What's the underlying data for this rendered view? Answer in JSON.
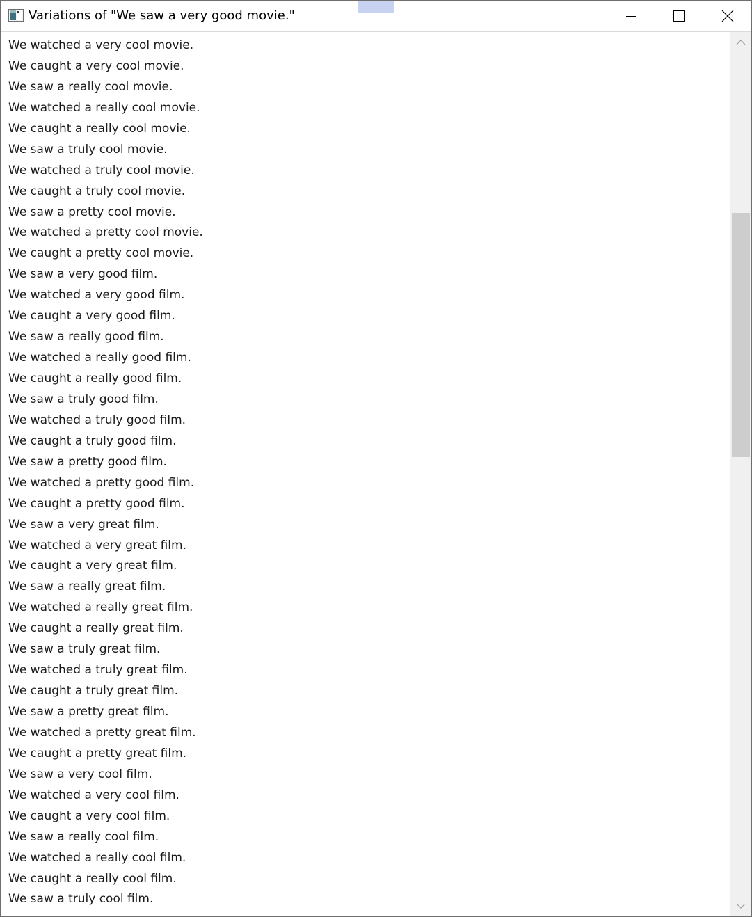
{
  "window": {
    "title": "Variations of \"We saw a very good movie.\""
  },
  "titlebar": {
    "app_icon": "window-app-icon",
    "grip_icon": "grip-handle-icon",
    "buttons": [
      {
        "name": "minimize",
        "icon": "minimize-icon"
      },
      {
        "name": "maximize",
        "icon": "maximize-icon"
      },
      {
        "name": "close",
        "icon": "close-icon"
      }
    ]
  },
  "list": {
    "items": [
      "We watched a very cool movie.",
      "We caught a very cool movie.",
      "We saw a really cool movie.",
      "We watched a really cool movie.",
      "We caught a really cool movie.",
      "We saw a truly cool movie.",
      "We watched a truly cool movie.",
      "We caught a truly cool movie.",
      "We saw a pretty cool movie.",
      "We watched a pretty cool movie.",
      "We caught a pretty cool movie.",
      "We saw a very good film.",
      "We watched a very good film.",
      "We caught a very good film.",
      "We saw a really good film.",
      "We watched a really good film.",
      "We caught a really good film.",
      "We saw a truly good film.",
      "We watched a truly good film.",
      "We caught a truly good film.",
      "We saw a pretty good film.",
      "We watched a pretty good film.",
      "We caught a pretty good film.",
      "We saw a very great film.",
      "We watched a very great film.",
      "We caught a very great film.",
      "We saw a really great film.",
      "We watched a really great film.",
      "We caught a really great film.",
      "We saw a truly great film.",
      "We watched a truly great film.",
      "We caught a truly great film.",
      "We saw a pretty great film.",
      "We watched a pretty great film.",
      "We caught a pretty great film.",
      "We saw a very cool film.",
      "We watched a very cool film.",
      "We caught a very cool film.",
      "We saw a really cool film.",
      "We watched a really cool film.",
      "We caught a really cool film.",
      "We saw a truly cool film."
    ]
  },
  "scrollbar": {
    "position_fraction": 0.19,
    "visible_fraction": 0.29,
    "up_icon": "chevron-up-icon",
    "down_icon": "chevron-down-icon"
  },
  "colors": {
    "grip_fill": "#c7d2f0",
    "scroll_thumb": "#cdcdcd",
    "scroll_track": "#f0f0f0"
  }
}
